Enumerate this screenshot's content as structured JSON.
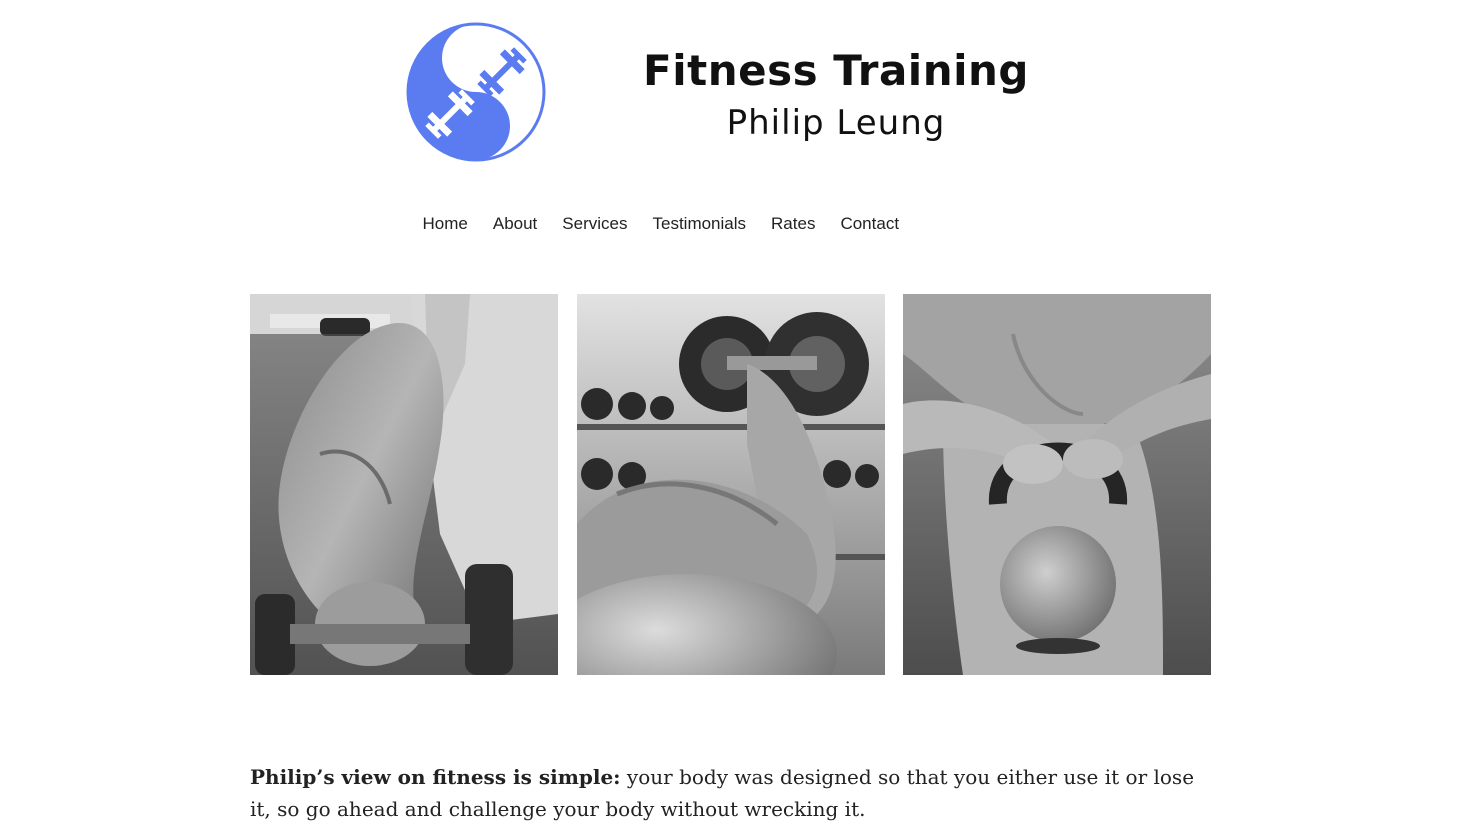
{
  "header": {
    "logo_icon": "yin-yang-dumbbell-icon",
    "brand_color": "#5b7cf0",
    "title": "Fitness Training",
    "subtitle": "Philip Leung"
  },
  "nav": {
    "items": [
      {
        "label": "Home"
      },
      {
        "label": "About"
      },
      {
        "label": "Services"
      },
      {
        "label": "Testimonials"
      },
      {
        "label": "Rates"
      },
      {
        "label": "Contact"
      }
    ]
  },
  "gallery": {
    "photos": [
      {
        "subject": "dumbbell-front-raise-photo"
      },
      {
        "subject": "dumbbell-curl-on-ball-photo"
      },
      {
        "subject": "kettlebell-hold-photo"
      }
    ]
  },
  "intro": {
    "lead": "Philip’s view on fitness is simple:",
    "text": " your body was designed so that you either use it or lose it, so go ahead and challenge your body without wrecking it."
  }
}
